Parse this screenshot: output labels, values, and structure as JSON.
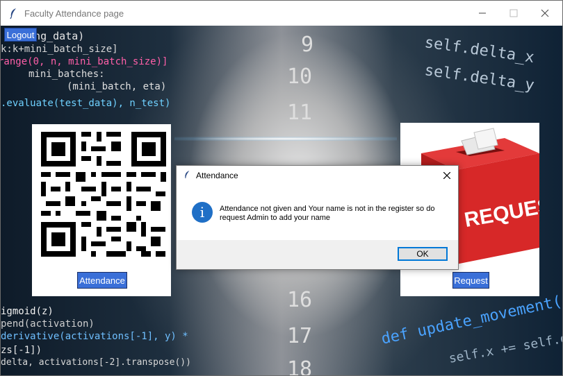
{
  "window": {
    "title": "Faculty Attendance page",
    "minimize_icon": "minimize-icon",
    "maximize_icon": "maximize-icon",
    "close_icon": "close-icon"
  },
  "toolbar": {
    "logout_label": "Logout"
  },
  "attendance_card": {
    "button_label": "Attendance",
    "image": "qr-code"
  },
  "request_card": {
    "button_label": "Request",
    "image_text": "REQUESTS",
    "image": "red-request-box"
  },
  "background_code": [
    "ning_data)",
    "k:k+mini_batch_size]",
    "range(0, n, mini_batch_size)]",
    "mini_batches:",
    "(mini_batch, eta)",
    ".evaluate(test_data), n_test)",
    "igmoid(z)",
    "pend(activation)",
    "derivative(activations[-1], y) *",
    "zs[-1])",
    "delta, activations[-2].transpose())",
    "def update_movement(self",
    "self.delta_x",
    "self.delta_y",
    "self.x += self.delta"
  ],
  "background_numbers": [
    "9",
    "10",
    "11",
    "16",
    "17",
    "18"
  ],
  "dialog": {
    "title": "Attendance",
    "message": "Attendance not given and Your name is not in the register so do request Admin to add your name",
    "ok_label": "OK",
    "icon": "info-icon"
  },
  "colors": {
    "button_blue": "#3a6fd8",
    "info_blue": "#1f6fc6",
    "ok_border": "#0078d7"
  }
}
